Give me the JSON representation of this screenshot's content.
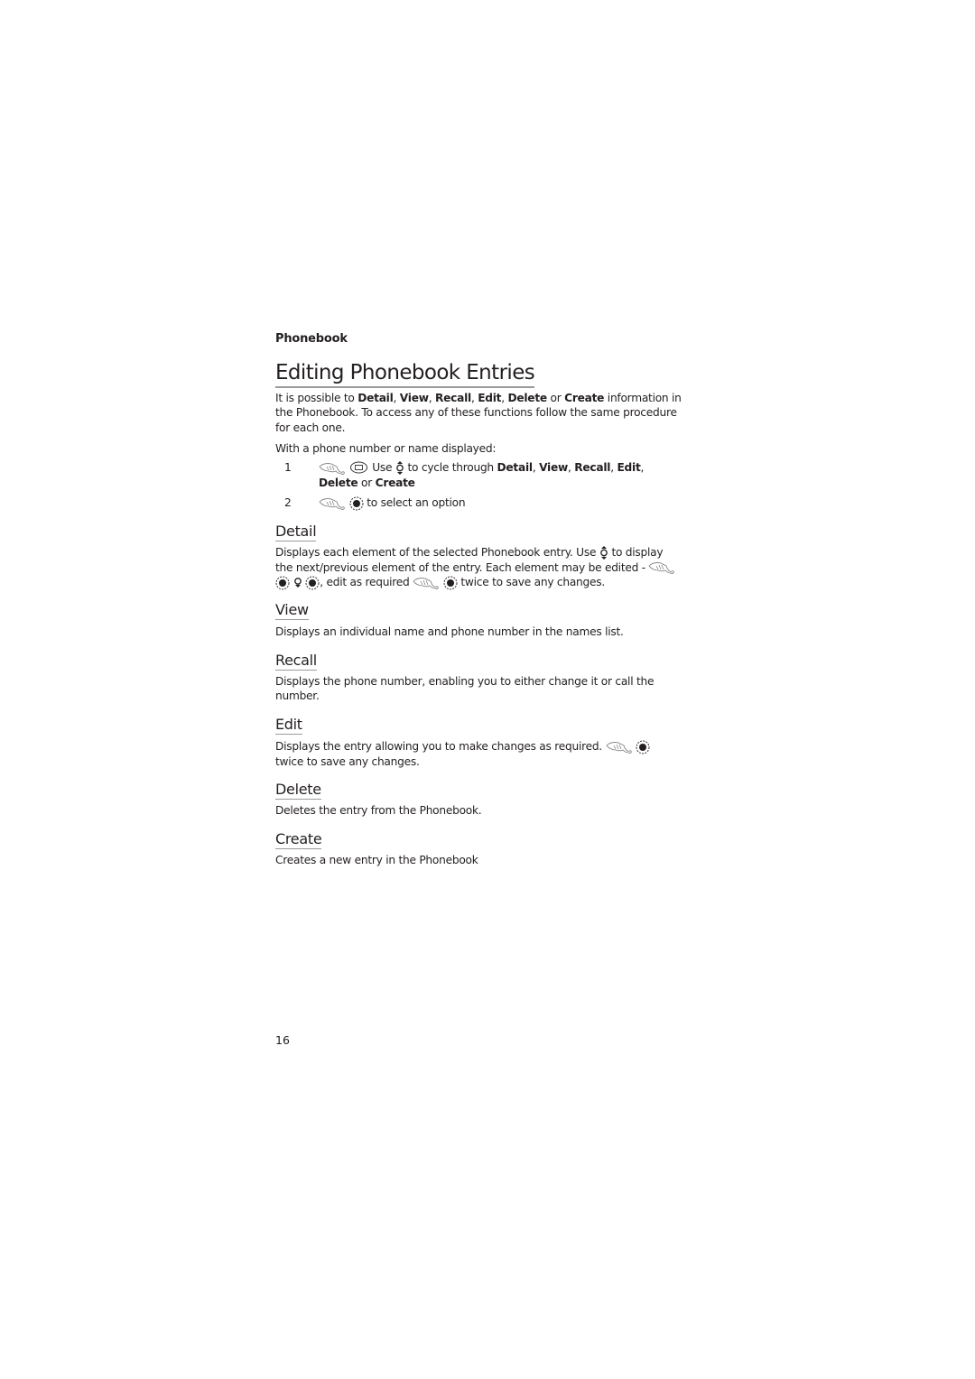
{
  "header": {
    "running_head": "Phonebook"
  },
  "title": "Editing Phonebook Entries",
  "intro": {
    "t1": "It is possible to ",
    "b1": "Detail",
    "t2": ", ",
    "b2": "View",
    "t3": ", ",
    "b3": "Recall",
    "t4": ", ",
    "b4": "Edit",
    "t5": ", ",
    "b5": "Delete",
    "t6": " or ",
    "b6": "Create",
    "t7": " information in the Phonebook. To access any of these functions follow the same procedure for each one."
  },
  "precondition": "With a phone number or name displayed:",
  "steps": [
    {
      "number": "1",
      "icons": [
        "hand-press-icon",
        "menu-key-icon"
      ],
      "t1": "Use ",
      "icon_mid": "up-down-navigation-icon",
      "t2": " to cycle through ",
      "b1": "Detail",
      "t3": ", ",
      "b2": "View",
      "t4": ", ",
      "b3": "Recall",
      "t5": ", ",
      "b4": "Edit",
      "t6": ",",
      "b5": "Delete",
      "t7": " or ",
      "b6": "Create"
    },
    {
      "number": "2",
      "icons": [
        "hand-press-icon",
        "select-key-icon"
      ],
      "text": " to select an option"
    }
  ],
  "sections": [
    {
      "heading": "Detail",
      "t1": "Displays each element of the selected Phonebook entry. Use ",
      "t2": " to display the next/previous element of the entry. Each element may be edited - ",
      "t3": ", edit as required ",
      "t4": " twice to save any changes."
    },
    {
      "heading": "View",
      "text": "Displays an individual name and phone number in the names list."
    },
    {
      "heading": "Recall",
      "text": "Displays the phone number, enabling you to either change it or call the number."
    },
    {
      "heading": "Edit",
      "t1": "Displays the entry allowing you to make changes as required. ",
      "t2": " twice to save any changes."
    },
    {
      "heading": "Delete",
      "text": "Deletes the entry from the Phonebook."
    },
    {
      "heading": "Create",
      "text": "Creates a new entry in the Phonebook"
    }
  ],
  "footer": {
    "page_number": "16"
  }
}
